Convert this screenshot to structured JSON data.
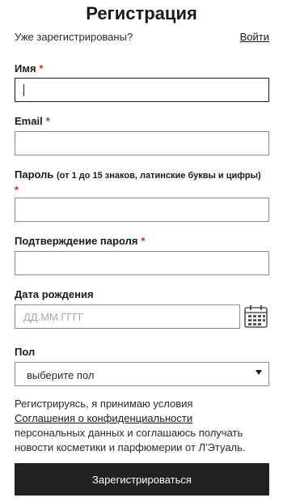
{
  "form": {
    "title": "Регистрация",
    "already_registered": "Уже зарегистрированы?",
    "login_link": "Войти",
    "required_mark": "*",
    "name": {
      "label": "Имя",
      "value": ""
    },
    "email": {
      "label": "Email",
      "value": ""
    },
    "password": {
      "label": "Пароль",
      "hint": "(от 1 до 15 знаков, латинские буквы и цифры)",
      "value": ""
    },
    "password_confirm": {
      "label": "Подтверждение пароля",
      "value": ""
    },
    "birth_date": {
      "label": "Дата рождения",
      "placeholder": "ДД.ММ.ГГГГ",
      "calendar_icon": "calendar-icon"
    },
    "gender": {
      "label": "Пол",
      "selected": "выберите пол",
      "caret_icon": "caret-down-icon"
    },
    "agreement": {
      "line1": "Регистрируясь, я принимаю условия",
      "link": "Соглашения о конфиденциальности",
      "line3": "персональных данных и соглашаюсь получать",
      "line4": "новости косметики и парфюмерии от Л'Этуаль."
    },
    "submit_label": "Зарегистрироваться"
  },
  "colors": {
    "accent_required": "#d9282f",
    "button_bg": "#222222",
    "button_text": "#ffffff",
    "input_border": "#8c8c8c",
    "active_input_border": "#1a1a1a"
  }
}
